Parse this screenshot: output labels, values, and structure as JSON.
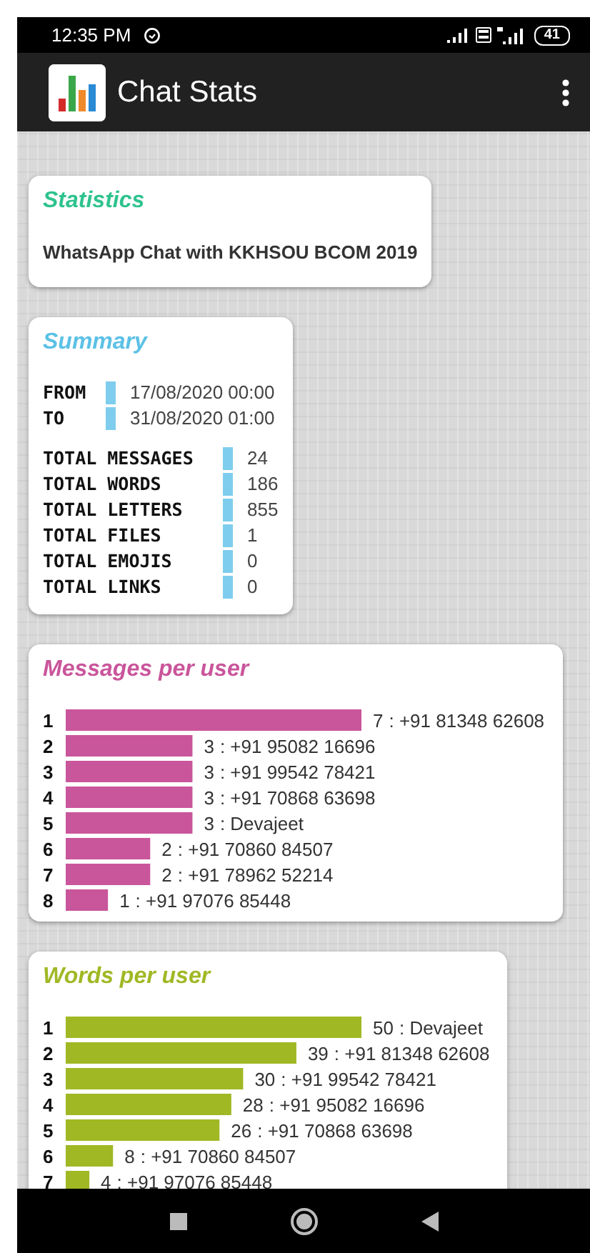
{
  "status_bar": {
    "time": "12:35 PM",
    "battery": "41"
  },
  "app_bar": {
    "title": "Chat Stats"
  },
  "statistics": {
    "title": "Statistics",
    "chat_name": "WhatsApp Chat with KKHSOU BCOM 2019"
  },
  "summary": {
    "title": "Summary",
    "period": [
      {
        "label": "FROM",
        "value": "17/08/2020 00:00"
      },
      {
        "label": "TO",
        "value": "31/08/2020 01:00"
      }
    ],
    "totals": [
      {
        "label": "TOTAL MESSAGES",
        "value": "24"
      },
      {
        "label": "TOTAL WORDS",
        "value": "186"
      },
      {
        "label": "TOTAL LETTERS",
        "value": "855"
      },
      {
        "label": "TOTAL FILES",
        "value": "1"
      },
      {
        "label": "TOTAL EMOJIS",
        "value": "0"
      },
      {
        "label": "TOTAL LINKS",
        "value": "0"
      }
    ]
  },
  "messages_per_user": {
    "title": "Messages per user",
    "chart_data": {
      "type": "bar",
      "orientation": "horizontal",
      "categories": [
        "1",
        "2",
        "3",
        "4",
        "5",
        "6",
        "7",
        "8"
      ],
      "data_labels": true,
      "series": [
        {
          "color": "#c9559b",
          "values": [
            7,
            3,
            3,
            3,
            3,
            2,
            2,
            1
          ]
        }
      ]
    },
    "users": [
      ": +91 81348 62608",
      ": +91 95082 16696",
      ": +91 99542 78421",
      ": +91 70868 63698",
      ": Devajeet",
      ": +91 70860 84507",
      ": +91 78962 52214",
      ": +91 97076 85448"
    ]
  },
  "words_per_user": {
    "title": "Words per user",
    "chart_data": {
      "type": "bar",
      "orientation": "horizontal",
      "categories": [
        "1",
        "2",
        "3",
        "4",
        "5",
        "6",
        "7"
      ],
      "data_labels": true,
      "series": [
        {
          "color": "#a0b824",
          "values": [
            50,
            39,
            30,
            28,
            26,
            8,
            4
          ]
        }
      ]
    },
    "users": [
      ": Devajeet",
      ": +91 81348 62608",
      ": +91 99542 78421",
      ": +91 95082 16696",
      ": +91 70868 63698",
      ": +91 70860 84507",
      ": +91 97076 85448"
    ]
  }
}
